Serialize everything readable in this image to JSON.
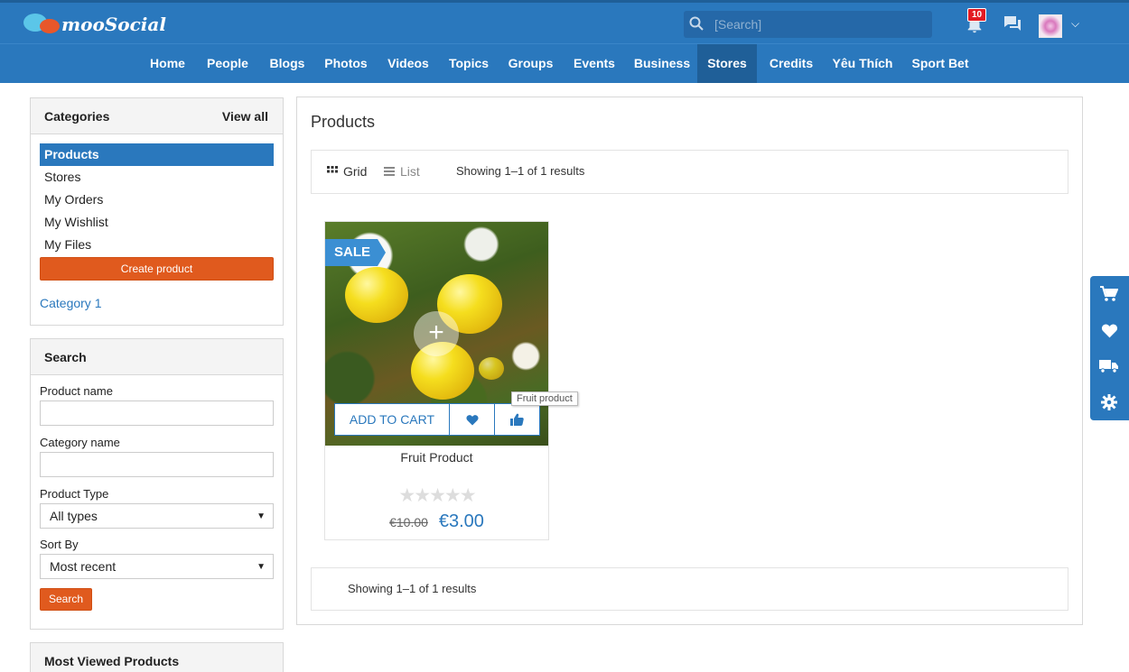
{
  "header": {
    "logo_text": "mooSocial",
    "search_placeholder": "[Search]",
    "notification_count": "10"
  },
  "nav": {
    "items": [
      "Home",
      "People",
      "Blogs",
      "Photos",
      "Videos",
      "Topics",
      "Groups",
      "Events",
      "Business",
      "Stores",
      "Credits",
      "Yêu Thích",
      "Sport Bet"
    ],
    "active": "Stores"
  },
  "categories": {
    "title": "Categories",
    "view_all": "View all",
    "items": [
      "Products",
      "Stores",
      "My Orders",
      "My Wishlist",
      "My Files"
    ],
    "create_label": "Create product",
    "category_link": "Category 1"
  },
  "search_panel": {
    "title": "Search",
    "product_name_label": "Product name",
    "category_name_label": "Category name",
    "product_type_label": "Product Type",
    "product_type_value": "All types",
    "sort_by_label": "Sort By",
    "sort_by_value": "Most recent",
    "search_button": "Search"
  },
  "most_viewed": {
    "title": "Most Viewed Products"
  },
  "main": {
    "title": "Products",
    "grid_label": "Grid",
    "list_label": "List",
    "showing_text": "Showing 1–1 of 1 results",
    "footer_showing": "Showing 1–1 of 1 results"
  },
  "product": {
    "sale_label": "SALE",
    "add_to_cart": "ADD TO CART",
    "tooltip": "Fruit product",
    "name": "Fruit Product",
    "rating": 0,
    "stars_text": "★★★★★",
    "old_price": "€10.00",
    "new_price": "€3.00"
  },
  "colors": {
    "primary": "#2a78bd",
    "accent": "#e05a1e"
  }
}
